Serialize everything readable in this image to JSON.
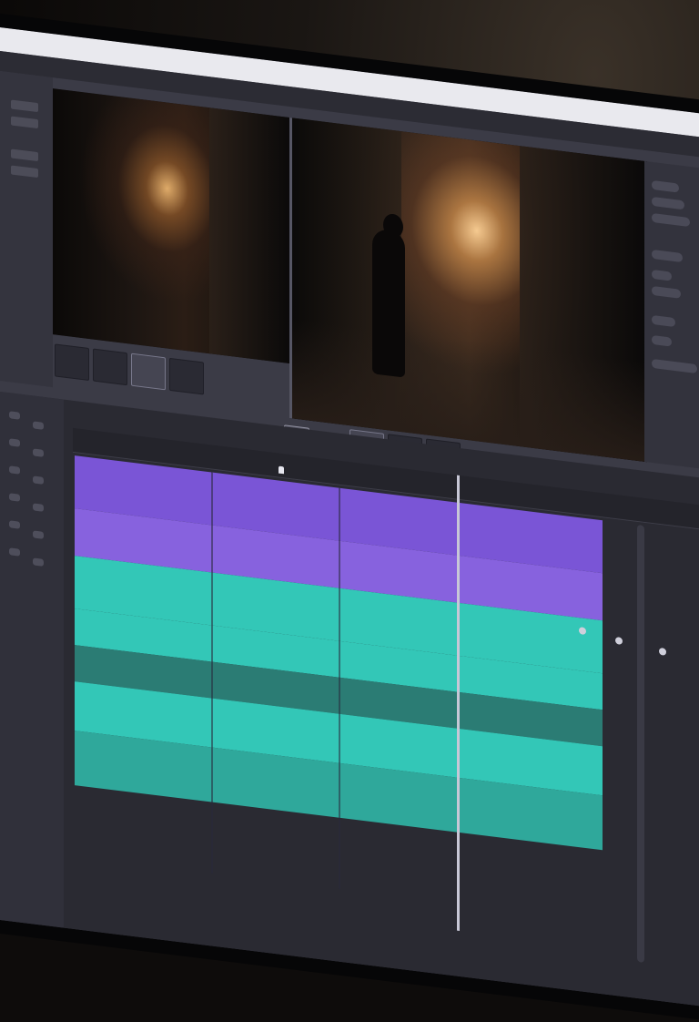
{
  "window": {
    "title": ""
  },
  "menu": {
    "items": [
      "",
      "",
      "",
      ""
    ]
  },
  "source_viewer": {
    "label": ""
  },
  "program_viewer": {
    "header": "",
    "timecode": ""
  },
  "timeline": {
    "ruler_labels": [
      "",
      ""
    ],
    "track_count": 7
  },
  "colors": {
    "accent_purple": "#7a55d6",
    "accent_teal": "#33c7b7",
    "panel_bg": "#2f2f38",
    "screen_bg": "#3b3b46"
  },
  "icons": [
    "play-icon",
    "playhead-marker-icon",
    "slider-knob-icon",
    "scroll-handle-icon"
  ]
}
